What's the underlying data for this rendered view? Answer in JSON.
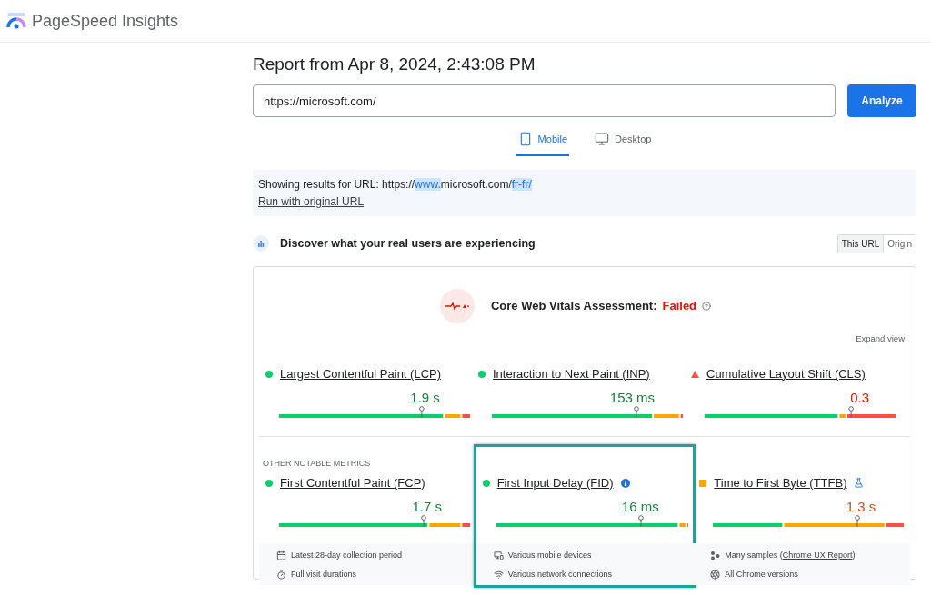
{
  "header": {
    "title": "PageSpeed Insights"
  },
  "report": {
    "title": "Report from Apr 8, 2024, 2:43:08 PM",
    "url_value": "https://microsoft.com/",
    "analyze_button": "Analyze"
  },
  "tabs": [
    {
      "label": "Mobile",
      "kind": "mobile",
      "selected": true
    },
    {
      "label": "Desktop",
      "kind": "desktop",
      "selected": false
    }
  ],
  "notice": {
    "parts": [
      {
        "text": "Showing results for URL: https://",
        "highlighted": false
      },
      {
        "text": "www.",
        "highlighted": true
      },
      {
        "text": "microsoft.com/",
        "highlighted": false
      },
      {
        "text": "fr-fr/",
        "highlighted": true
      }
    ],
    "link": "Run with original URL"
  },
  "field_data": {
    "heading": "Discover what your real users are experiencing",
    "toggle": [
      {
        "label": "This URL",
        "selected": true
      },
      {
        "label": "Origin",
        "selected": false
      }
    ]
  },
  "assessment": {
    "label": "Core Web Vitals Assessment:",
    "result": "Failed",
    "passed": false,
    "expand": "Expand view"
  },
  "core_metrics": [
    {
      "label": "Largest Contentful Paint (LCP)",
      "value": "1.9 s",
      "kind": "good"
    },
    {
      "label": "Interaction to Next Paint (INP)",
      "value": "153 ms",
      "kind": "good"
    },
    {
      "label": "Cumulative Layout Shift (CLS)",
      "value": "0.3",
      "kind": "poor"
    }
  ],
  "other_metrics_label": "OTHER NOTABLE METRICS",
  "other_metrics": [
    {
      "label": "First Contentful Paint (FCP)",
      "value": "1.7 s",
      "kind": "good",
      "highlighted": false,
      "notes": [
        {
          "kind": "calendar",
          "text": "Latest 28-day collection period"
        },
        {
          "kind": "timer",
          "text": "Full visit durations"
        }
      ]
    },
    {
      "label": "First Input Delay (FID)",
      "value": "16 ms",
      "kind": "good",
      "badge": {
        "kind": "info"
      },
      "highlighted": true,
      "notes": [
        {
          "kind": "devices",
          "text": "Various mobile devices"
        },
        {
          "kind": "wifi",
          "text": "Various network connections"
        }
      ]
    },
    {
      "label": "Time to First Byte (TTFB)",
      "value": "1.3 s",
      "kind": "needs",
      "badge": {
        "kind": "flask"
      },
      "highlighted": false,
      "notes": [
        {
          "kind": "samples",
          "text": "Many samples (",
          "link": "Chrome UX Report",
          "after": ")"
        },
        {
          "kind": "browser",
          "text": "All Chrome versions"
        }
      ]
    }
  ]
}
